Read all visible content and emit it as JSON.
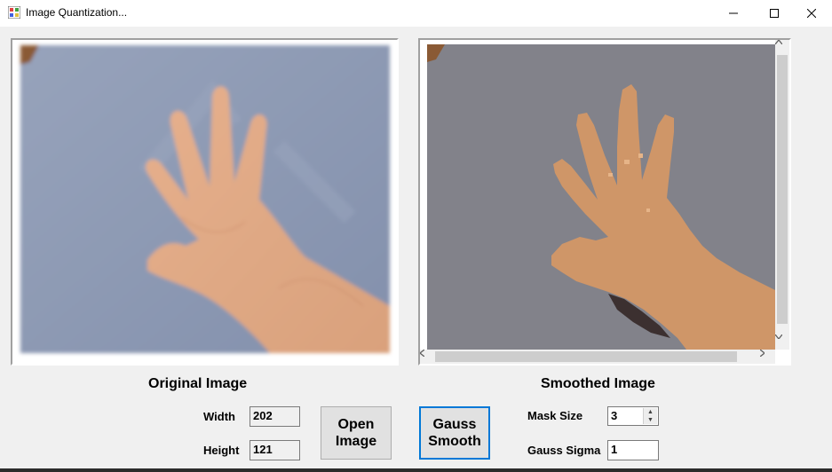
{
  "window": {
    "title": "Image Quantization..."
  },
  "panels": {
    "original_caption": "Original Image",
    "smoothed_caption": "Smoothed Image"
  },
  "fields": {
    "width_label": "Width",
    "width_value": "202",
    "height_label": "Height",
    "height_value": "121",
    "mask_size_label": "Mask Size",
    "mask_size_value": "3",
    "gauss_sigma_label": "Gauss Sigma",
    "gauss_sigma_value": "1"
  },
  "buttons": {
    "open_image": "Open\nImage",
    "gauss_smooth": "Gauss\nSmooth"
  },
  "icons": {
    "app": "app-icon",
    "minimize": "minimize-icon",
    "maximize": "maximize-icon",
    "close": "close-icon",
    "scroll_up": "chevron-up-icon",
    "scroll_down": "chevron-down-icon",
    "scroll_left": "chevron-left-icon",
    "scroll_right": "chevron-right-icon"
  },
  "colors": {
    "original_background": "#8e9bb5",
    "skin": "#e2ab86",
    "smoothed_background": "#82828a",
    "smoothed_skin": "#cf9668",
    "focus_border": "#0078d7"
  }
}
